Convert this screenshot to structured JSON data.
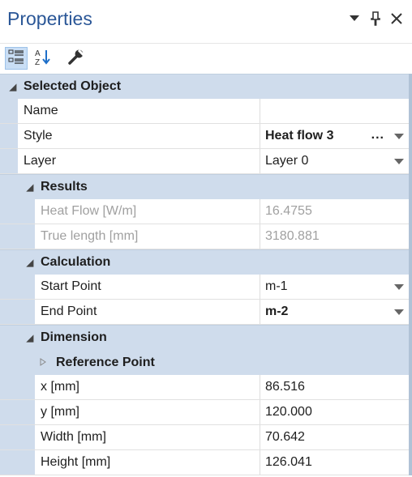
{
  "panel": {
    "title": "Properties"
  },
  "selected_object": {
    "label": "Selected Object",
    "rows": [
      {
        "name": "Name",
        "value": ""
      },
      {
        "name": "Style",
        "value": "Heat flow 3",
        "ellipsis": "..."
      },
      {
        "name": "Layer",
        "value": "Layer 0"
      }
    ]
  },
  "results": {
    "label": "Results",
    "rows": [
      {
        "name": "Heat Flow [W/m]",
        "value": "16.4755"
      },
      {
        "name": "True length [mm]",
        "value": "3180.881"
      }
    ]
  },
  "calculation": {
    "label": "Calculation",
    "rows": [
      {
        "name": "Start Point",
        "value": "m-1"
      },
      {
        "name": "End Point",
        "value": "m-2"
      }
    ]
  },
  "dimension": {
    "label": "Dimension",
    "reference_point_label": "Reference Point",
    "rows": [
      {
        "name": "x [mm]",
        "value": "86.516"
      },
      {
        "name": "y [mm]",
        "value": "120.000"
      },
      {
        "name": "Width [mm]",
        "value": "70.642"
      },
      {
        "name": "Height [mm]",
        "value": "126.041"
      }
    ]
  },
  "icons": {
    "title_buttons": [
      "dropdown-icon",
      "pin-icon",
      "close-icon"
    ],
    "toolbar": [
      "categorized-icon",
      "sort-alpha-icon",
      "wrench-icon"
    ]
  },
  "colors": {
    "title": "#2b5797",
    "category_band": "#cfdcec",
    "active_button": "#c9def5"
  }
}
